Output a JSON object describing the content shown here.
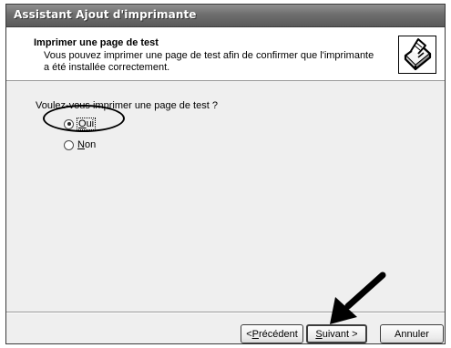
{
  "window": {
    "title": "Assistant Ajout d'imprimante"
  },
  "header": {
    "title": "Imprimer une page de test",
    "subtitle": "Vous pouvez imprimer une page de test afin de confirmer que l'imprimante a été installée correctement.",
    "icon": "printer-icon"
  },
  "content": {
    "question": "Voulez-vous imprimer une page de test ?",
    "options": [
      {
        "accel": "O",
        "rest": "ui",
        "selected": true
      },
      {
        "accel": "N",
        "rest": "on",
        "selected": false
      }
    ]
  },
  "buttons": {
    "prev_prefix": "< ",
    "prev_accel": "P",
    "prev_rest": "récédent",
    "next_accel": "S",
    "next_rest": "uivant >",
    "cancel": "Annuler"
  },
  "annotations": {
    "highlight": "ellipse around selected option",
    "arrow": "arrow pointing at next button",
    "color": "#000000"
  }
}
